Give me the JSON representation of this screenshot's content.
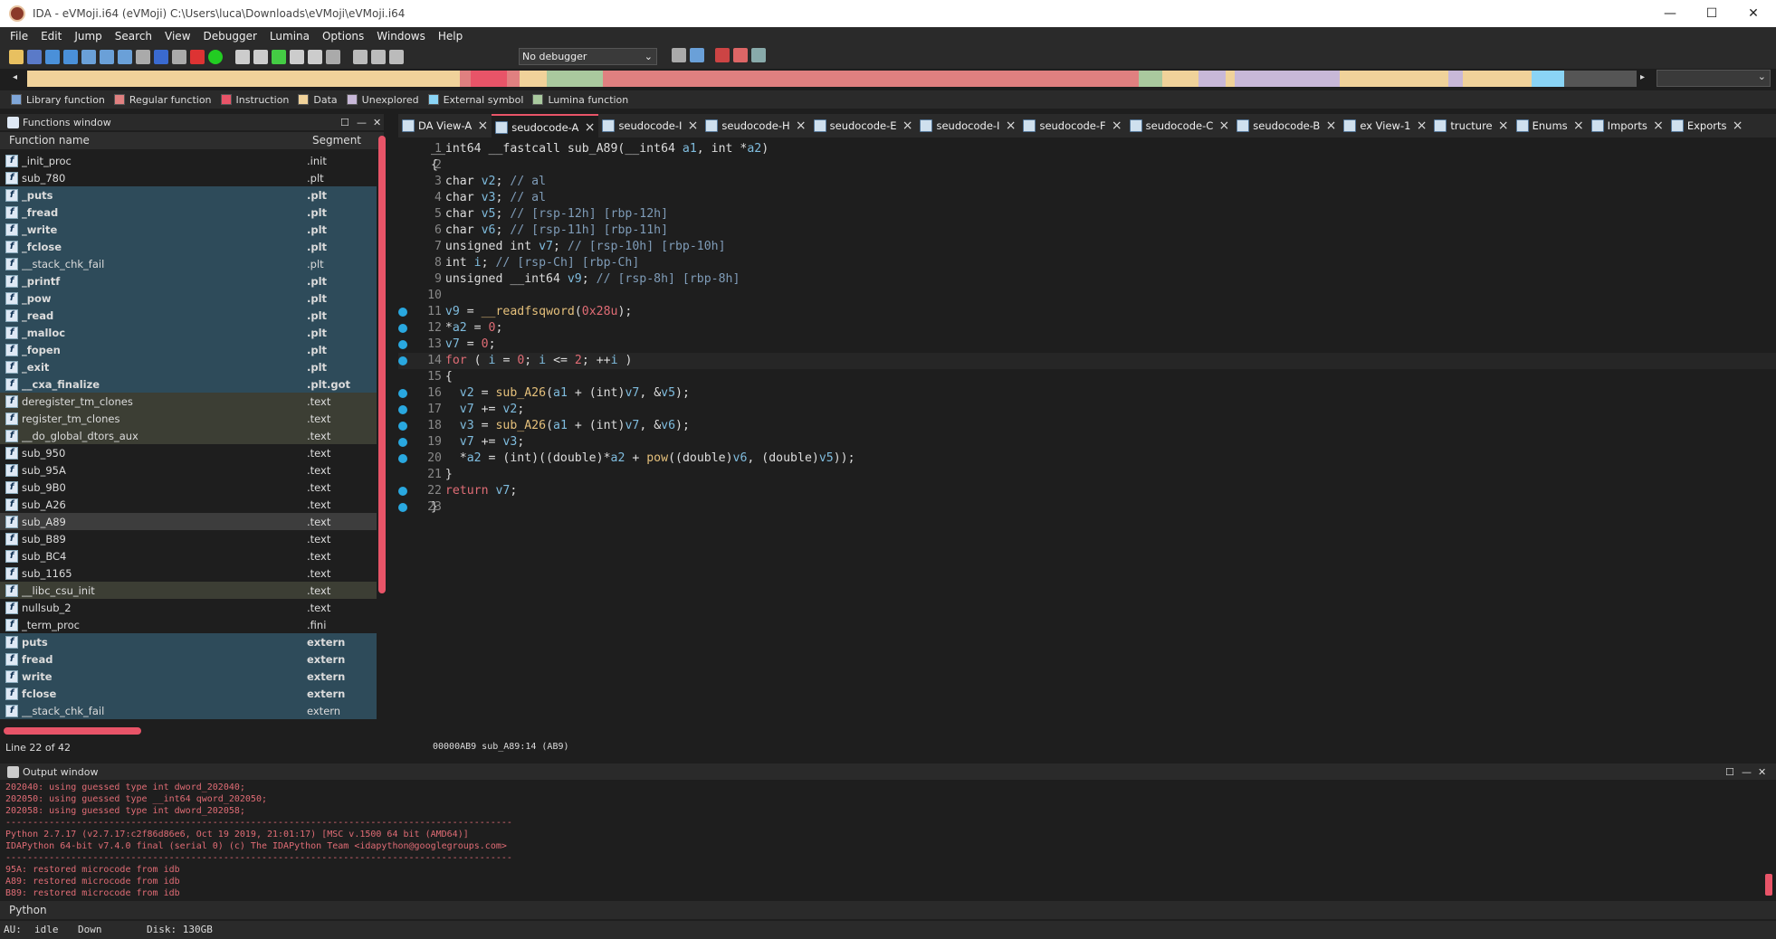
{
  "window": {
    "title": "IDA - eVMoji.i64 (eVMoji) C:\\Users\\luca\\Downloads\\eVMoji\\eVMoji.i64",
    "min": "—",
    "max": "☐",
    "close": "✕"
  },
  "menu": [
    "File",
    "Edit",
    "Jump",
    "Search",
    "View",
    "Debugger",
    "Lumina",
    "Options",
    "Windows",
    "Help"
  ],
  "debugger_select": "No debugger",
  "legend": [
    {
      "label": "Library function",
      "color": "#7fa6d8"
    },
    {
      "label": "Regular function",
      "color": "#e08080"
    },
    {
      "label": "Instruction",
      "color": "#e85468"
    },
    {
      "label": "Data",
      "color": "#f0d29a"
    },
    {
      "label": "Unexplored",
      "color": "#c8b8d8"
    },
    {
      "label": "External symbol",
      "color": "#8ad4f5"
    },
    {
      "label": "Lumina function",
      "color": "#a9c99e"
    }
  ],
  "functions_window": {
    "title": "Functions window",
    "col_name": "Function name",
    "col_segment": "Segment",
    "rows": [
      {
        "name": "_init_proc",
        "seg": ".init",
        "style": ""
      },
      {
        "name": "sub_780",
        "seg": ".plt",
        "style": ""
      },
      {
        "name": "_puts",
        "seg": ".plt",
        "style": "plt bold"
      },
      {
        "name": "_fread",
        "seg": ".plt",
        "style": "plt bold"
      },
      {
        "name": "_write",
        "seg": ".plt",
        "style": "plt bold"
      },
      {
        "name": "_fclose",
        "seg": ".plt",
        "style": "plt bold"
      },
      {
        "name": "__stack_chk_fail",
        "seg": ".plt",
        "style": "plt"
      },
      {
        "name": "_printf",
        "seg": ".plt",
        "style": "plt bold"
      },
      {
        "name": "_pow",
        "seg": ".plt",
        "style": "plt bold"
      },
      {
        "name": "_read",
        "seg": ".plt",
        "style": "plt bold"
      },
      {
        "name": "_malloc",
        "seg": ".plt",
        "style": "plt bold"
      },
      {
        "name": "_fopen",
        "seg": ".plt",
        "style": "plt bold"
      },
      {
        "name": "_exit",
        "seg": ".plt",
        "style": "plt bold"
      },
      {
        "name": "__cxa_finalize",
        "seg": ".plt.got",
        "style": "plt bold"
      },
      {
        "name": "deregister_tm_clones",
        "seg": ".text",
        "style": "txt"
      },
      {
        "name": "register_tm_clones",
        "seg": ".text",
        "style": "txt"
      },
      {
        "name": "__do_global_dtors_aux",
        "seg": ".text",
        "style": "txt"
      },
      {
        "name": "sub_950",
        "seg": ".text",
        "style": ""
      },
      {
        "name": "sub_95A",
        "seg": ".text",
        "style": ""
      },
      {
        "name": "sub_9B0",
        "seg": ".text",
        "style": ""
      },
      {
        "name": "sub_A26",
        "seg": ".text",
        "style": ""
      },
      {
        "name": "sub_A89",
        "seg": ".text",
        "style": "sel"
      },
      {
        "name": "sub_B89",
        "seg": ".text",
        "style": ""
      },
      {
        "name": "sub_BC4",
        "seg": ".text",
        "style": ""
      },
      {
        "name": "sub_1165",
        "seg": ".text",
        "style": ""
      },
      {
        "name": "__libc_csu_init",
        "seg": ".text",
        "style": "txt"
      },
      {
        "name": "nullsub_2",
        "seg": ".text",
        "style": ""
      },
      {
        "name": "_term_proc",
        "seg": ".fini",
        "style": ""
      },
      {
        "name": "puts",
        "seg": "extern",
        "style": "plt bold"
      },
      {
        "name": "fread",
        "seg": "extern",
        "style": "plt bold"
      },
      {
        "name": "write",
        "seg": "extern",
        "style": "plt bold"
      },
      {
        "name": "fclose",
        "seg": "extern",
        "style": "plt bold"
      },
      {
        "name": "__stack_chk_fail",
        "seg": "extern",
        "style": "plt"
      }
    ],
    "line_info": "Line 22 of 42"
  },
  "tabs": [
    {
      "label": "DA View-A",
      "active": false
    },
    {
      "label": "seudocode-A",
      "active": true
    },
    {
      "label": "seudocode-I",
      "active": false
    },
    {
      "label": "seudocode-H",
      "active": false
    },
    {
      "label": "seudocode-E",
      "active": false
    },
    {
      "label": "seudocode-I",
      "active": false
    },
    {
      "label": "seudocode-F",
      "active": false
    },
    {
      "label": "seudocode-C",
      "active": false
    },
    {
      "label": "seudocode-B",
      "active": false
    },
    {
      "label": "ex View-1",
      "active": false
    },
    {
      "label": "tructure",
      "active": false
    },
    {
      "label": "Enums",
      "active": false
    },
    {
      "label": "Imports",
      "active": false
    },
    {
      "label": "Exports",
      "active": false
    }
  ],
  "code": [
    {
      "n": "1",
      "dot": false,
      "html": "__int64 __fastcall sub_A89(__int64 a1, int *a2)"
    },
    {
      "n": "2",
      "dot": false,
      "html": "{"
    },
    {
      "n": "3",
      "dot": false,
      "html": "  char v2; // al"
    },
    {
      "n": "4",
      "dot": false,
      "html": "  char v3; // al"
    },
    {
      "n": "5",
      "dot": false,
      "html": "  char v5; // [rsp-12h] [rbp-12h]"
    },
    {
      "n": "6",
      "dot": false,
      "html": "  char v6; // [rsp-11h] [rbp-11h]"
    },
    {
      "n": "7",
      "dot": false,
      "html": "  unsigned int v7; // [rsp-10h] [rbp-10h]"
    },
    {
      "n": "8",
      "dot": false,
      "html": "  int i; // [rsp-Ch] [rbp-Ch]"
    },
    {
      "n": "9",
      "dot": false,
      "html": "  unsigned __int64 v9; // [rsp-8h] [rbp-8h]"
    },
    {
      "n": "10",
      "dot": false,
      "html": ""
    },
    {
      "n": "11",
      "dot": true,
      "html": "  v9 = __readfsqword(0x28u);"
    },
    {
      "n": "12",
      "dot": true,
      "html": "  *a2 = 0;"
    },
    {
      "n": "13",
      "dot": true,
      "html": "  v7 = 0;"
    },
    {
      "n": "14",
      "dot": true,
      "html": "  for ( i = 0; i <= 2; ++i )"
    },
    {
      "n": "15",
      "dot": false,
      "html": "  {"
    },
    {
      "n": "16",
      "dot": true,
      "html": "    v2 = sub_A26(a1 + (int)v7, &v5);"
    },
    {
      "n": "17",
      "dot": true,
      "html": "    v7 += v2;"
    },
    {
      "n": "18",
      "dot": true,
      "html": "    v3 = sub_A26(a1 + (int)v7, &v6);"
    },
    {
      "n": "19",
      "dot": true,
      "html": "    v7 += v3;"
    },
    {
      "n": "20",
      "dot": true,
      "html": "    *a2 = (int)((double)*a2 + pow((double)v6, (double)v5));"
    },
    {
      "n": "21",
      "dot": false,
      "html": "  }"
    },
    {
      "n": "22",
      "dot": true,
      "html": "  return v7;"
    },
    {
      "n": "23",
      "dot": true,
      "html": "}"
    }
  ],
  "address_line": "00000AB9 sub_A89:14 (AB9)",
  "output_window": {
    "title": "Output window",
    "lines": [
      "202040: using guessed type int dword_202040;",
      "202050: using guessed type __int64 qword_202050;",
      "202058: using guessed type int dword_202058;",
      "---------------------------------------------------------------------------------------------",
      "Python 2.7.17 (v2.7.17:c2f86d86e6, Oct 19 2019, 21:01:17) [MSC v.1500 64 bit (AMD64)]",
      "IDAPython 64-bit v7.4.0 final (serial 0) (c) The IDAPython Team <idapython@googlegroups.com>",
      "---------------------------------------------------------------------------------------------",
      "95A: restored microcode from idb",
      "A89: restored microcode from idb",
      "B89: restored microcode from idb"
    ]
  },
  "python_label": "Python",
  "status": {
    "au": "AU:",
    "state": "idle",
    "dir": "Down",
    "disk": "Disk: 130GB"
  }
}
